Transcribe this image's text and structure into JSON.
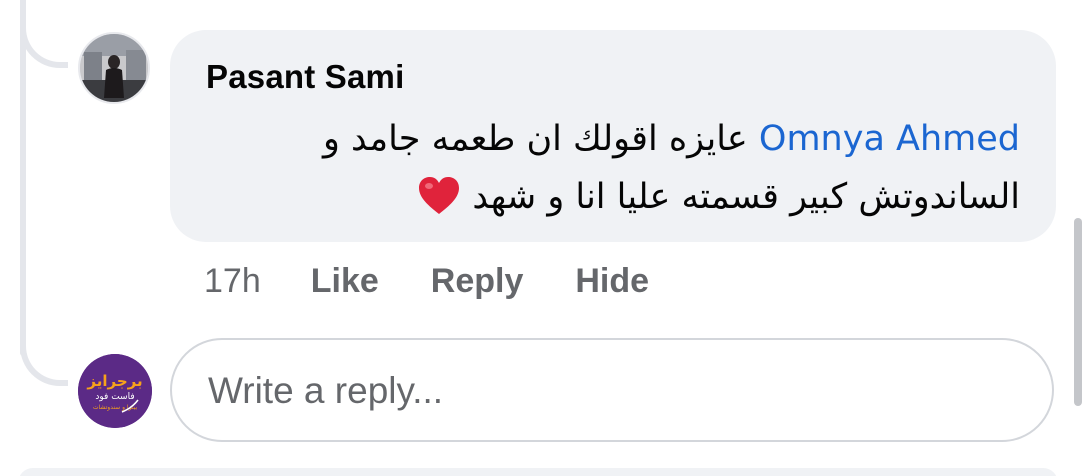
{
  "comment": {
    "author": "Pasant Sami",
    "mention": "Omnya Ahmed",
    "text_line1": "عايزه اقولك ان طعمه جامد و",
    "text_line2": "الساندوتش كبير قسمته عليا انا و شهد",
    "emoji_icon": "red-heart-icon",
    "time": "17h",
    "actions": {
      "like": "Like",
      "reply": "Reply",
      "hide": "Hide"
    }
  },
  "reply_input": {
    "placeholder": "Write a reply..."
  },
  "page_avatar": {
    "logo_text_main": "برجرايز",
    "logo_text_sub": "فاست فود",
    "logo_text_small": "بيتزا و سندوتشات"
  },
  "colors": {
    "bubble": "#f0f2f5",
    "mention": "#1b66d1",
    "secondary_text": "#65676b",
    "heart": "#e0233b",
    "page_avatar_bg": "#5b2a86",
    "logo_orange": "#f7a21b"
  }
}
